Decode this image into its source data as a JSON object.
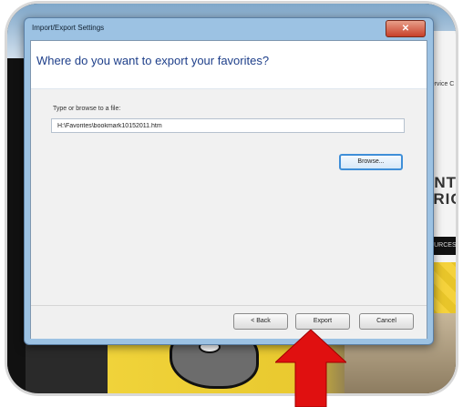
{
  "background": {
    "tab_label": "Service C",
    "logo_line1": "ENT",
    "logo_line2": "TRICT",
    "nav_label": "SOURCES"
  },
  "dialog": {
    "title": "Import/Export Settings",
    "close_glyph": "✕",
    "heading": "Where do you want to export your favorites?",
    "file_label": "Type or browse to a file:",
    "file_value": "H:\\Favorites\\bookmark10152011.htm",
    "browse_label": "Browse...",
    "back_label": "< Back",
    "export_label": "Export",
    "cancel_label": "Cancel"
  },
  "annotation": {
    "arrow_color": "#e01010",
    "arrow_icon": "up-arrow-icon"
  }
}
